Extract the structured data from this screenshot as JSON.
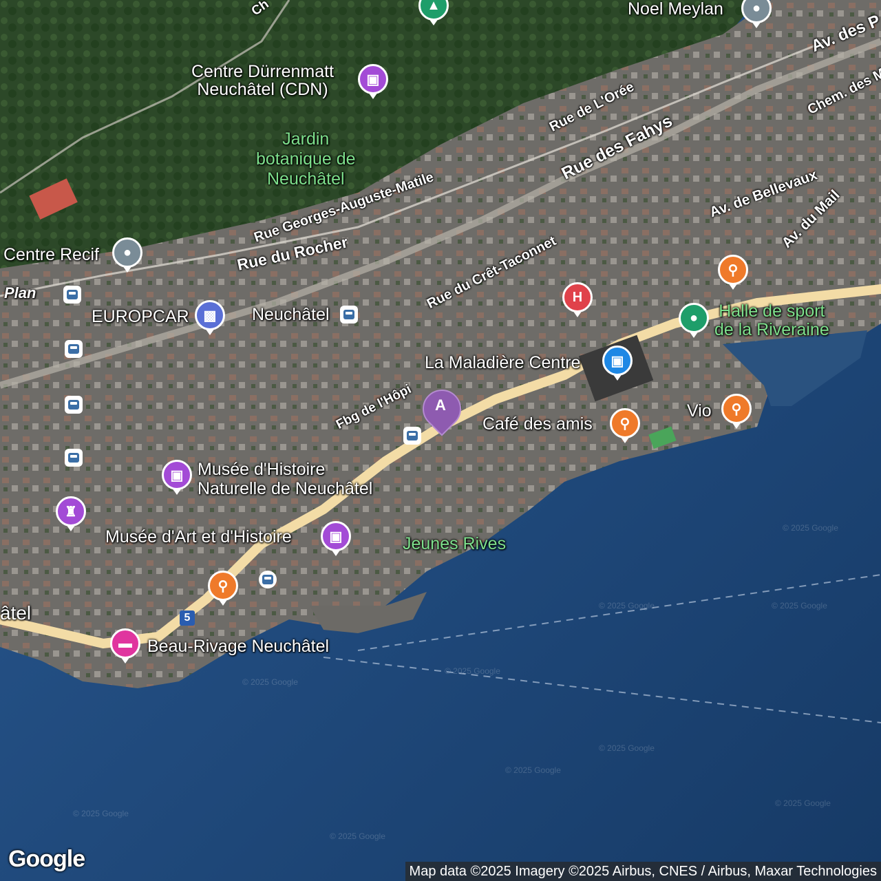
{
  "map": {
    "colors": {
      "water": "#1e4a80",
      "forest": "#2e4a2a",
      "urban": "#6b6a66",
      "highway": "#f3dca6"
    }
  },
  "poi_labels": {
    "noel_meylan": "Noel Meylan",
    "centre_durrenmatt": "Centre Dürrenmatt\nNeuchâtel (CDN)",
    "jardin_botanique": "Jardin\nbotanique de\nNeuchâtel",
    "centre_recif": "Centre Recif",
    "plan": "Plan",
    "europcar": "EUROPCAR",
    "neuchatel_station": "Neuchâtel",
    "halle_sport": "Halle de sport\nde la Riveraine",
    "maladiere": "La Maladière Centre",
    "cafe_amis": "Café des amis",
    "vio": "Vio",
    "musee_histoire_naturelle": "Musée d'Histoire\nNaturelle de Neuchâtel",
    "musee_art": "Musée d'Art et d'Histoire",
    "jeunes_rives": "Jeunes Rives",
    "beau_rivage": "Beau-Rivage Neuchâtel",
    "atel": "âtel"
  },
  "road_labels": {
    "av_des_p": "Av. des P",
    "rue_oree": "Rue de L'Orée",
    "chem_des_m": "Chem. des M",
    "rue_fahys": "Rue des Fahys",
    "av_bellevaux": "Av. de Bellevaux",
    "av_mail": "Av. du Mail",
    "rue_georges": "Rue Georges-Auguste-Matile",
    "rue_rocher": "Rue du Rocher",
    "rue_cret": "Rue du Crêt-Taconnet",
    "fbg_hopi": "Fbg de l'Hôpi",
    "ch": "Ch"
  },
  "marker": {
    "label": "A"
  },
  "route_shield": "5",
  "watermark": "© 2025 Google",
  "logo": "Google",
  "attribution": "Map data ©2025 Imagery ©2025 Airbus, CNES / Airbus, Maxar Technologies",
  "icons": {
    "park": "tree-icon",
    "landmark": "pin-icon",
    "museum": "museum-icon",
    "hospital": "hospital-icon",
    "restaurant": "fork-knife-icon",
    "shopping": "shopping-bag-icon",
    "car_rental": "car-icon",
    "transit": "train-icon",
    "hotel": "bed-icon",
    "castle": "castle-icon",
    "ferry": "ferry-icon"
  }
}
